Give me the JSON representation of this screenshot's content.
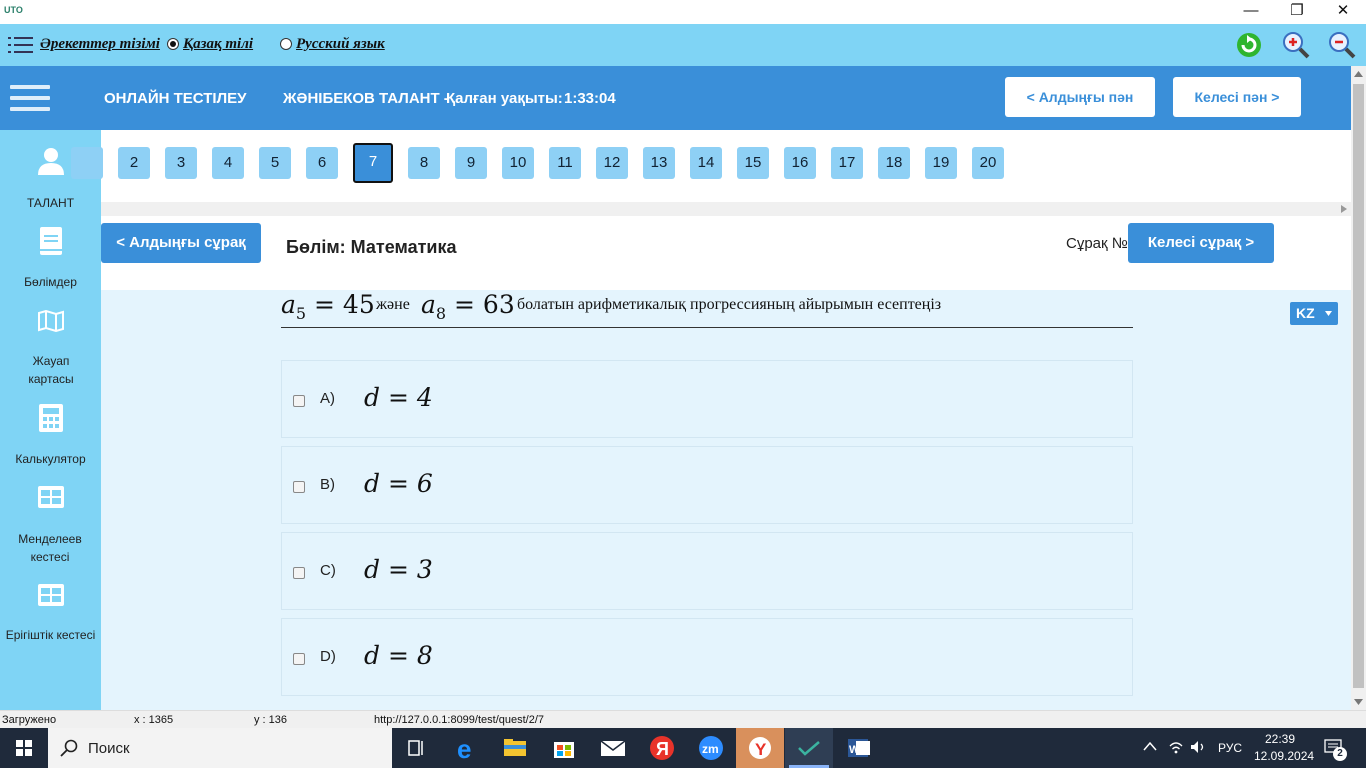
{
  "titlebar": {
    "logo": "UTO",
    "minimize": "—",
    "restore": "❐",
    "close": "✕"
  },
  "menubar": {
    "actions_list": "Әрекеттер тізімі",
    "kazakh": "Қазақ тілі",
    "russian": "Русский язык",
    "selected_language": "kazakh"
  },
  "header": {
    "title": "ОНЛАЙН ТЕСТІЛЕУ",
    "student": "ЖӘНІБЕКОВ ТАЛАНТ -",
    "time_label": "Қалған уақыты:",
    "time_value": "1:33:04",
    "prev_subject": "< Алдыңғы пән",
    "next_subject": "Келесі пән >"
  },
  "sidebar": {
    "items": [
      {
        "label": "ТАЛАНТ",
        "icon": "user-icon"
      },
      {
        "label": "Бөлімдер",
        "icon": "book-icon"
      },
      {
        "label": "Жауап картасы",
        "icon": "map-icon"
      },
      {
        "label": "Калькулятор",
        "icon": "calculator-icon"
      },
      {
        "label": "Менделеев кестесі",
        "icon": "table-icon"
      },
      {
        "label": "Ерігіштік кестесі",
        "icon": "table-icon"
      }
    ]
  },
  "question_numbers": [
    "2",
    "3",
    "4",
    "5",
    "6",
    "7",
    "8",
    "9",
    "10",
    "11",
    "12",
    "13",
    "14",
    "15",
    "16",
    "17",
    "18",
    "19",
    "20"
  ],
  "current_question": "7",
  "section": {
    "prev_question": "< Алдыңғы сұрақ",
    "title": "Бөлім: Математика",
    "question_label": "Сұрақ №",
    "next_question": "Келесі сұрақ >"
  },
  "question": {
    "a5": "a",
    "a5_sub": "5",
    "a5_eq": " = 45",
    "connector": "және",
    "a8": "a",
    "a8_sub": "8",
    "a8_eq": " = 63",
    "text": "болатын арифметикалық прогрессияның айырымын есептеңіз"
  },
  "answers": [
    {
      "letter": "A)",
      "formula": "d = 4"
    },
    {
      "letter": "B)",
      "formula": "d = 6"
    },
    {
      "letter": "C)",
      "formula": "d = 3"
    },
    {
      "letter": "D)",
      "formula": "d = 8"
    }
  ],
  "language_select": "KZ",
  "statusbar": {
    "status": "Загружено",
    "x": "x : 1365",
    "y": "y : 136",
    "url": "http://127.0.0.1:8099/test/quest/2/7"
  },
  "taskbar": {
    "search": "Поиск",
    "language": "РУС",
    "time": "22:39",
    "date": "12.09.2024",
    "notifications": "2"
  },
  "colors": {
    "accent": "#3a8fd9",
    "sidebar": "#7fd4f5",
    "question_button": "#8ed0f5",
    "content_bg": "#e4f4fd"
  }
}
